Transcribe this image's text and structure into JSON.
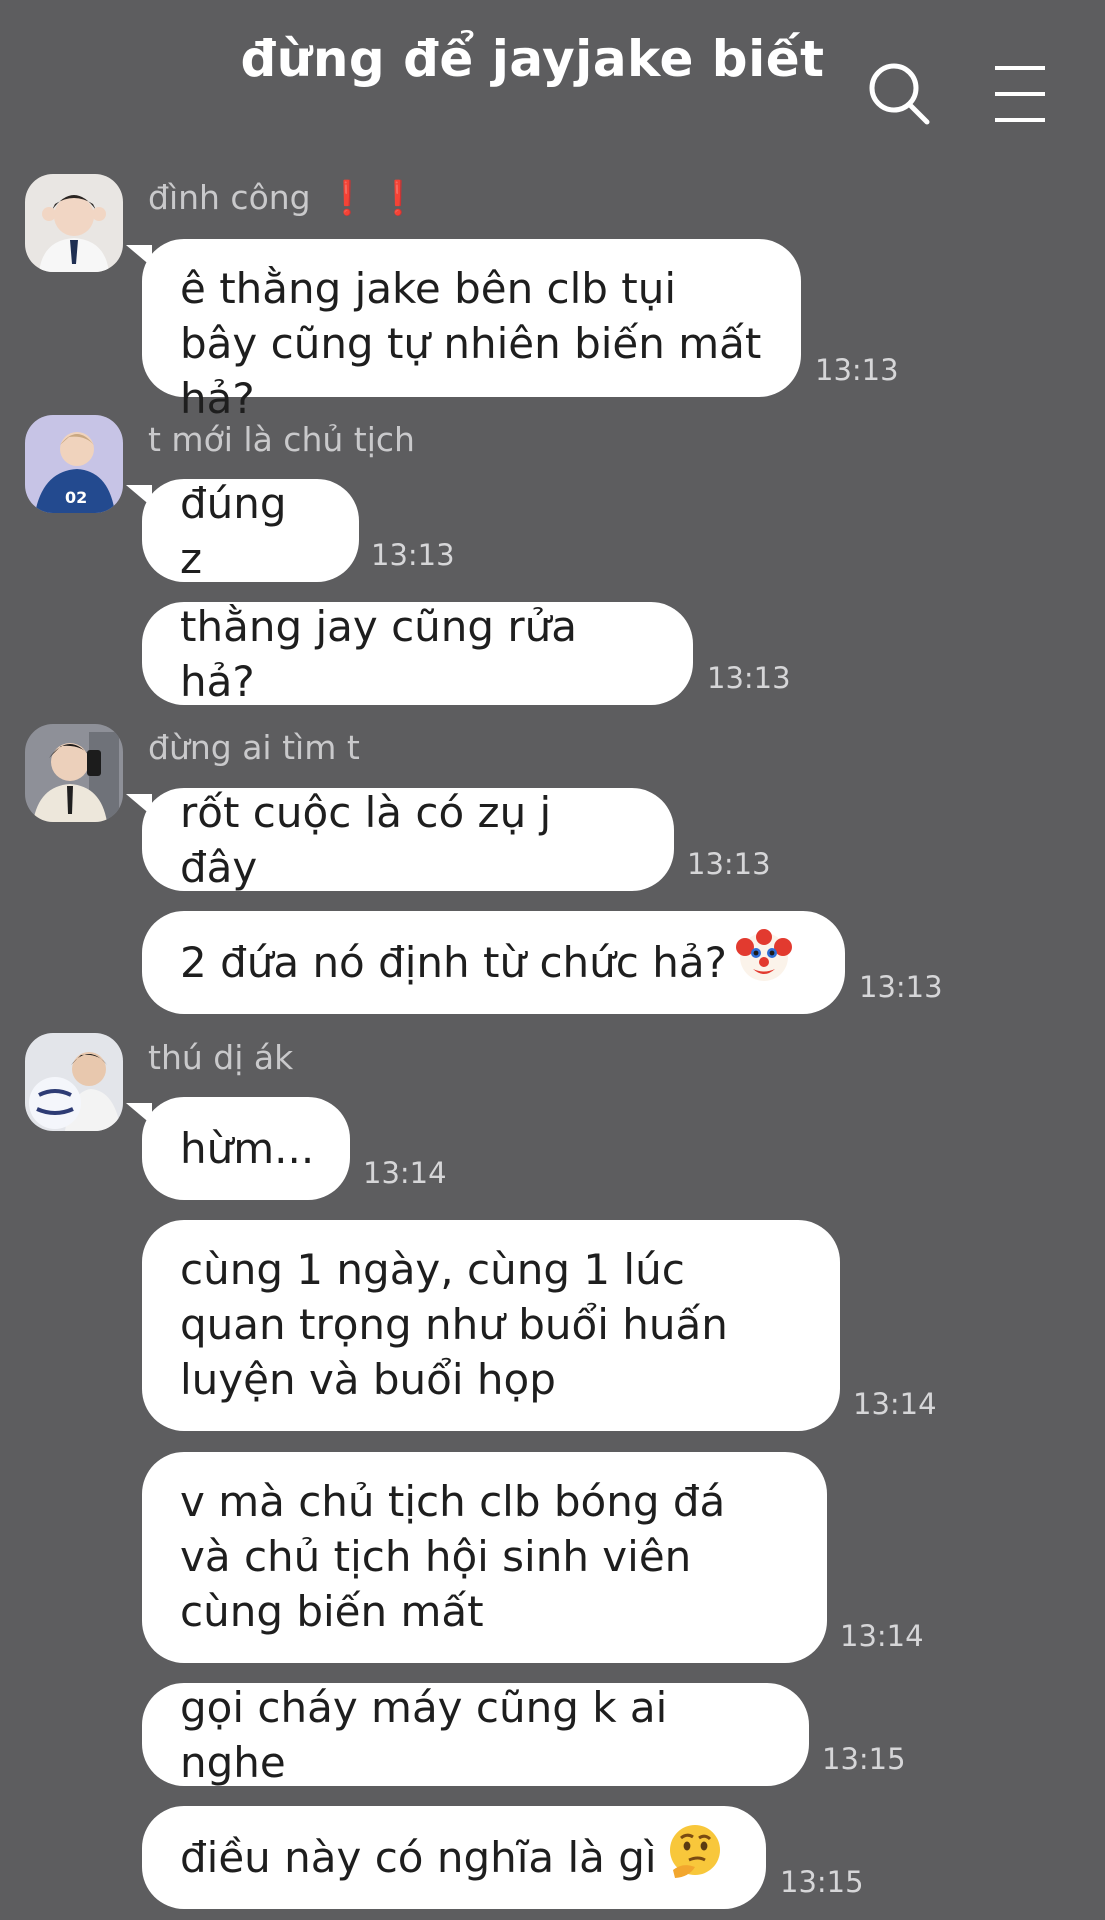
{
  "header": {
    "title": "đừng để jayjake biết",
    "search_icon": "search-icon",
    "menu_icon": "hamburger-menu-icon"
  },
  "colors": {
    "background": "#5d5d5f",
    "bubble": "#ffffff",
    "text": "#1e1e1e",
    "alert_mark": "#e0201e"
  },
  "messages": [
    {
      "sender": "đình công",
      "sender_marks": "❗❗",
      "text": "ê thằng jake bên clb tụi bây cũng tự nhiên biến mất hả?",
      "time": "13:13"
    },
    {
      "sender": "t mới là chủ tịch",
      "text": "đúng z",
      "time": "13:13"
    },
    {
      "text": "thằng jay cũng rửa hả?",
      "time": "13:13"
    },
    {
      "sender": "đừng ai tìm t",
      "text": "rốt cuộc là có zụ j đây",
      "time": "13:13"
    },
    {
      "text": "2 đứa nó định từ chức hả?",
      "emoji": "clown-face-emoji",
      "time": "13:13"
    },
    {
      "sender": "thú dị ák",
      "text": "hừm...",
      "time": "13:14"
    },
    {
      "text": "cùng 1 ngày, cùng 1 lúc quan trọng như buổi huấn luyện và buổi họp",
      "time": "13:14"
    },
    {
      "text": "v mà chủ tịch clb bóng đá và chủ tịch hội sinh viên cùng biến mất",
      "time": "13:14"
    },
    {
      "text": "gọi cháy máy cũng k ai nghe",
      "time": "13:15"
    },
    {
      "text": "điều này có nghĩa là gì",
      "emoji": "thinking-face-emoji",
      "time": "13:15"
    }
  ]
}
